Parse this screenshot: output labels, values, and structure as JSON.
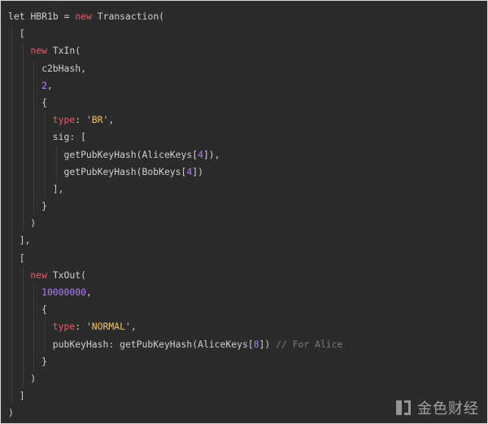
{
  "code": {
    "lines": [
      {
        "indent": 0,
        "tokens": [
          {
            "t": "let ",
            "c": "punct"
          },
          {
            "t": "HBR1b",
            "c": "punct"
          },
          {
            "t": " = ",
            "c": "punct"
          },
          {
            "t": "new",
            "c": "kw"
          },
          {
            "t": " Transaction(",
            "c": "punct"
          }
        ]
      },
      {
        "indent": 1,
        "tokens": [
          {
            "t": "[",
            "c": "punct"
          }
        ]
      },
      {
        "indent": 2,
        "tokens": [
          {
            "t": "new",
            "c": "kw"
          },
          {
            "t": " TxIn(",
            "c": "punct"
          }
        ]
      },
      {
        "indent": 3,
        "tokens": [
          {
            "t": "c2bHash,",
            "c": "punct"
          }
        ]
      },
      {
        "indent": 3,
        "tokens": [
          {
            "t": "2",
            "c": "num"
          },
          {
            "t": ",",
            "c": "punct"
          }
        ]
      },
      {
        "indent": 3,
        "tokens": [
          {
            "t": "{",
            "c": "punct"
          }
        ]
      },
      {
        "indent": 4,
        "tokens": [
          {
            "t": "type",
            "c": "type"
          },
          {
            "t": ": ",
            "c": "punct"
          },
          {
            "t": "'BR'",
            "c": "str"
          },
          {
            "t": ",",
            "c": "punct"
          }
        ]
      },
      {
        "indent": 4,
        "tokens": [
          {
            "t": "sig: [",
            "c": "punct"
          }
        ]
      },
      {
        "indent": 5,
        "tokens": [
          {
            "t": "getPubKeyHash(AliceKeys[",
            "c": "punct"
          },
          {
            "t": "4",
            "c": "num"
          },
          {
            "t": "]),",
            "c": "punct"
          }
        ]
      },
      {
        "indent": 5,
        "tokens": [
          {
            "t": "getPubKeyHash(BobKeys[",
            "c": "punct"
          },
          {
            "t": "4",
            "c": "num"
          },
          {
            "t": "])",
            "c": "punct"
          }
        ]
      },
      {
        "indent": 4,
        "tokens": [
          {
            "t": "],",
            "c": "punct"
          }
        ]
      },
      {
        "indent": 3,
        "tokens": [
          {
            "t": "}",
            "c": "punct"
          }
        ]
      },
      {
        "indent": 2,
        "tokens": [
          {
            "t": ")",
            "c": "punct"
          }
        ]
      },
      {
        "indent": 1,
        "tokens": [
          {
            "t": "],",
            "c": "punct"
          }
        ]
      },
      {
        "indent": 1,
        "tokens": [
          {
            "t": "[",
            "c": "punct"
          }
        ]
      },
      {
        "indent": 2,
        "tokens": [
          {
            "t": "new",
            "c": "kw"
          },
          {
            "t": " TxOut(",
            "c": "punct"
          }
        ]
      },
      {
        "indent": 3,
        "tokens": [
          {
            "t": "10000000",
            "c": "num"
          },
          {
            "t": ",",
            "c": "punct"
          }
        ]
      },
      {
        "indent": 3,
        "tokens": [
          {
            "t": "{",
            "c": "punct"
          }
        ]
      },
      {
        "indent": 4,
        "tokens": [
          {
            "t": "type",
            "c": "type"
          },
          {
            "t": ": ",
            "c": "punct"
          },
          {
            "t": "'NORMAL'",
            "c": "str"
          },
          {
            "t": ",",
            "c": "punct"
          }
        ]
      },
      {
        "indent": 4,
        "tokens": [
          {
            "t": "pubKeyHash: getPubKeyHash(AliceKeys[",
            "c": "punct"
          },
          {
            "t": "8",
            "c": "num"
          },
          {
            "t": "]) ",
            "c": "punct"
          },
          {
            "t": "// For Alice",
            "c": "cmt"
          }
        ]
      },
      {
        "indent": 3,
        "tokens": [
          {
            "t": "}",
            "c": "punct"
          }
        ]
      },
      {
        "indent": 2,
        "tokens": [
          {
            "t": ")",
            "c": "punct"
          }
        ]
      },
      {
        "indent": 1,
        "tokens": [
          {
            "t": "]",
            "c": "punct"
          }
        ]
      },
      {
        "indent": 0,
        "tokens": [
          {
            "t": ")",
            "c": "punct"
          }
        ]
      }
    ]
  },
  "watermark": {
    "text": "金色财经",
    "logo_icon": "jinse-logo-icon"
  },
  "colors": {
    "background": "#2b2b2b",
    "keyword": "#e65a68",
    "string": "#f2c36b",
    "number": "#b07cff",
    "comment": "#7b7b7b",
    "text": "#d7d7d7"
  }
}
